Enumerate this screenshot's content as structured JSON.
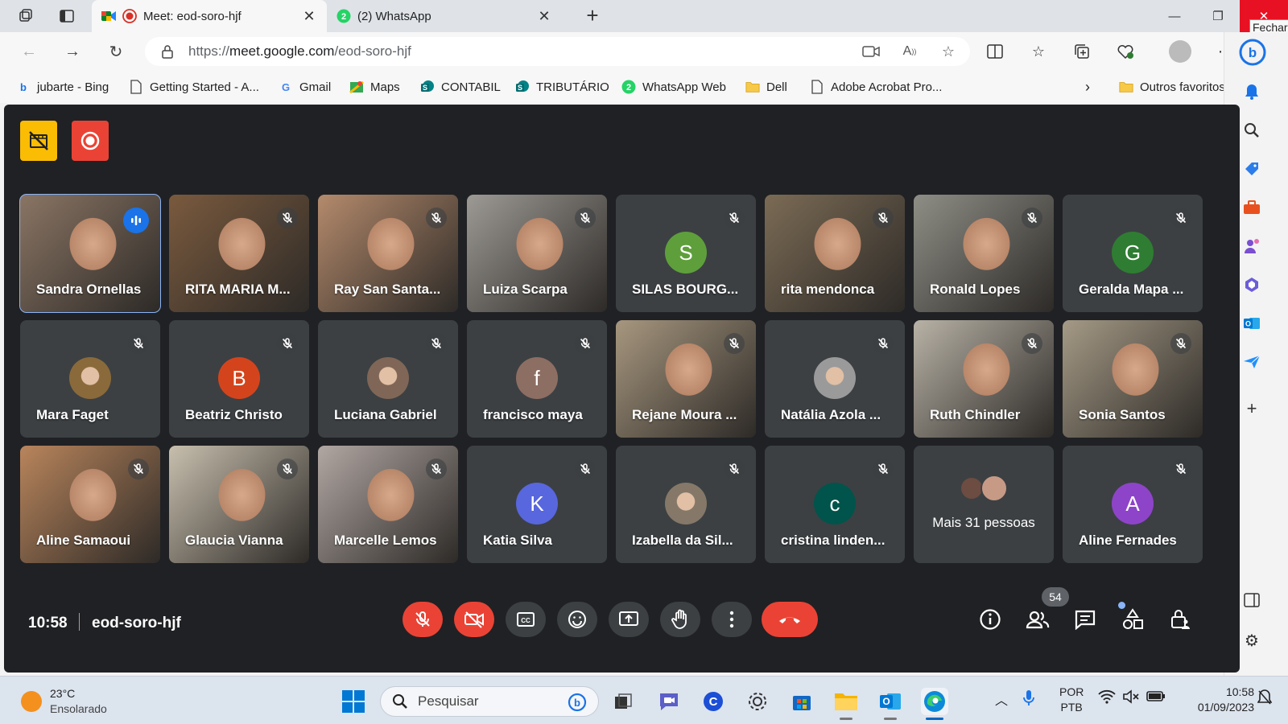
{
  "browser": {
    "tabs": [
      {
        "title": "Meet: eod-soro-hjf",
        "active": true
      },
      {
        "title": "(2) WhatsApp",
        "active": false
      }
    ],
    "close_tooltip": "Fechar",
    "url_prefix": "https://",
    "url_host": "meet.google.com",
    "url_path": "/eod-soro-hjf",
    "bookmarks": [
      {
        "label": "jubarte - Bing",
        "icon": "bing-icon"
      },
      {
        "label": "Getting Started - A...",
        "icon": "page-icon"
      },
      {
        "label": "Gmail",
        "icon": "google-icon"
      },
      {
        "label": "Maps",
        "icon": "maps-icon"
      },
      {
        "label": "CONTABIL",
        "icon": "sharepoint-icon"
      },
      {
        "label": "TRIBUTÁRIO",
        "icon": "sharepoint-icon"
      },
      {
        "label": "WhatsApp Web",
        "icon": "whatsapp-icon"
      },
      {
        "label": "Dell",
        "icon": "folder-icon"
      },
      {
        "label": "Adobe Acrobat Pro...",
        "icon": "page-icon"
      }
    ],
    "other_favorites": "Outros favoritos",
    "whatsapp_badge": "2"
  },
  "meet": {
    "participants": [
      {
        "name": "Sandra Ornellas",
        "type": "video",
        "speaking": true,
        "photo_color": "#8a7564"
      },
      {
        "name": "RITA MARIA M...",
        "type": "video",
        "photo_color": "#7a5a3e"
      },
      {
        "name": "Ray San Santa...",
        "type": "video",
        "photo_color": "#b48a6c"
      },
      {
        "name": "Luiza Scarpa",
        "type": "video",
        "photo_color": "#9d9a95"
      },
      {
        "name": "SILAS BOURG...",
        "type": "letter",
        "letter": "S",
        "color": "#5e9f3b"
      },
      {
        "name": "rita mendonca",
        "type": "video",
        "photo_color": "#7b6b55"
      },
      {
        "name": "Ronald Lopes",
        "type": "video",
        "photo_color": "#8e8e86"
      },
      {
        "name": "Geralda Mapa ...",
        "type": "letter",
        "letter": "G",
        "color": "#2f7d32"
      },
      {
        "name": "Mara Faget",
        "type": "avatar",
        "photo_color": "#8a6a3a"
      },
      {
        "name": "Beatriz Christo",
        "type": "letter",
        "letter": "B",
        "color": "#d4441c"
      },
      {
        "name": "Luciana Gabriel",
        "type": "avatar",
        "photo_color": "#7f6656"
      },
      {
        "name": "francisco maya",
        "type": "letter",
        "letter": "f",
        "color": "#8d6e63"
      },
      {
        "name": "Rejane Moura ...",
        "type": "video",
        "photo_color": "#a7977f"
      },
      {
        "name": "Natália Azola ...",
        "type": "avatar",
        "photo_color": "#9a9a9a"
      },
      {
        "name": "Ruth Chindler",
        "type": "video",
        "photo_color": "#b8b2a6"
      },
      {
        "name": "Sonia Santos",
        "type": "video",
        "photo_color": "#a59a86"
      },
      {
        "name": "Aline Samaoui",
        "type": "video",
        "photo_color": "#b9855c"
      },
      {
        "name": "Glaucia Vianna",
        "type": "video",
        "photo_color": "#c8bfae"
      },
      {
        "name": "Marcelle Lemos",
        "type": "video",
        "photo_color": "#b1a7a3"
      },
      {
        "name": "Katia Silva",
        "type": "letter",
        "letter": "K",
        "color": "#5867dd"
      },
      {
        "name": "Izabella da Sil...",
        "type": "avatar",
        "photo_color": "#857868"
      },
      {
        "name": "cristina linden...",
        "type": "letter",
        "letter": "c",
        "color": "#00544b"
      },
      {
        "name": "Mais 31 pessoas",
        "type": "more"
      },
      {
        "name": "Aline Fernades",
        "type": "letter",
        "letter": "A",
        "color": "#8e44c9"
      }
    ],
    "clock": "10:58",
    "meeting_code": "eod-soro-hjf",
    "participant_count": "54"
  },
  "taskbar": {
    "temperature": "23°C",
    "weather": "Ensolarado",
    "search_placeholder": "Pesquisar",
    "lang_1": "POR",
    "lang_2": "PTB",
    "time": "10:58",
    "date": "01/09/2023"
  }
}
